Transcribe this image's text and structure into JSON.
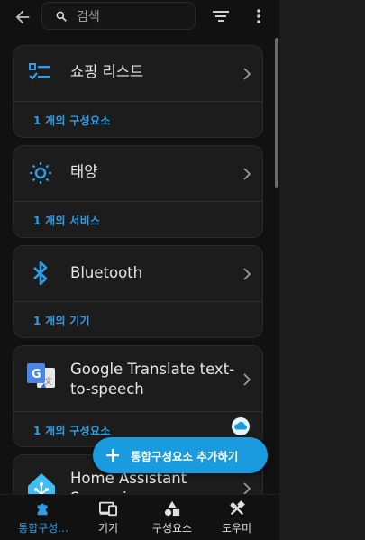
{
  "search": {
    "placeholder": "검색"
  },
  "icons": {
    "back": "arrow-left-icon",
    "search": "search-icon",
    "filter": "filter-icon",
    "more": "more-vert-icon"
  },
  "colors": {
    "accent": "#2f9ee6",
    "fab": "#1a9be0",
    "card": "#1c1c1c",
    "background": "#111111"
  },
  "cards": [
    {
      "title": "쇼핑 리스트",
      "count": "1 개의 구성요소",
      "icon": "checklist-icon"
    },
    {
      "title": "태양",
      "count": "1 개의 서비스",
      "icon": "sun-icon"
    },
    {
      "title": "Bluetooth",
      "count": "1 개의 기기",
      "icon": "bluetooth-icon"
    },
    {
      "title_line1": "Google Translate text-",
      "title_line2": "to-speech",
      "count": "1 개의 구성요소",
      "icon": "google-translate-icon"
    },
    {
      "title_line1": "Home Assistant",
      "title_line2": "Supervisor",
      "icon": "home-assistant-icon"
    }
  ],
  "fab": {
    "label": "통합구성요소 추가하기"
  },
  "bottom_nav": [
    {
      "label": "통합구성...",
      "icon": "puzzle-icon",
      "active": true
    },
    {
      "label": "기기",
      "icon": "devices-icon",
      "active": false
    },
    {
      "label": "구성요소",
      "icon": "shapes-icon",
      "active": false
    },
    {
      "label": "도우미",
      "icon": "tools-icon",
      "active": false
    }
  ]
}
